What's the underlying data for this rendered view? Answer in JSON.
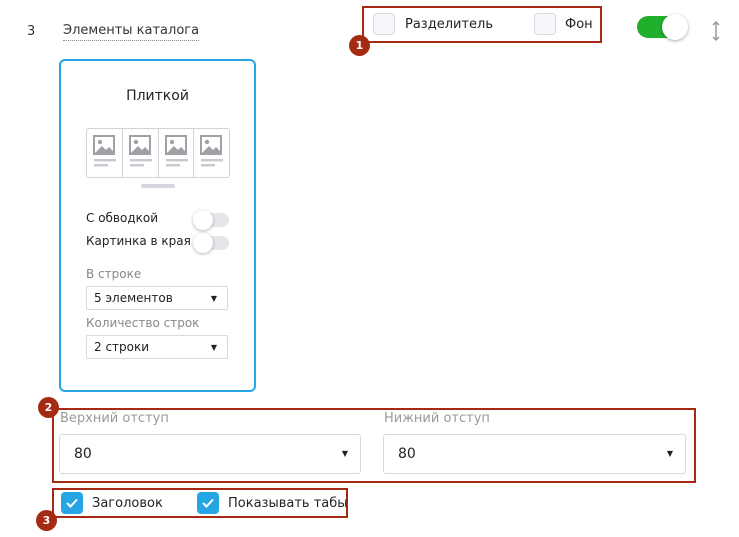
{
  "section": {
    "number": "3",
    "title": "Элементы каталога"
  },
  "badges": [
    "1",
    "2",
    "3"
  ],
  "options": {
    "divider_label": "Разделитель",
    "background_label": "Фон",
    "divider_checked": false,
    "background_checked": false
  },
  "section_toggle": {
    "enabled": true,
    "color": "#21b02c"
  },
  "card": {
    "title": "Плиткой",
    "border_color": "#26a5e4",
    "bordered_label": "С обводкой",
    "bordered_on": false,
    "edge_image_label": "Картинка в края",
    "edge_image_on": false,
    "per_row_label": "В строке",
    "per_row_value": "5 элементов",
    "rows_label": "Количество строк",
    "rows_value": "2 строки"
  },
  "spacing": {
    "top_label": "Верхний отступ",
    "top_value": "80",
    "bottom_label": "Нижний отступ",
    "bottom_value": "80"
  },
  "checks": {
    "heading_label": "Заголовок",
    "heading_checked": true,
    "tabs_label": "Показывать табы",
    "tabs_checked": true,
    "check_color": "#26a5e4"
  },
  "icons": [
    "image-icon",
    "chevron-down-icon",
    "checkmark-icon",
    "drag-handle-icon"
  ],
  "annotation_color": "#a52a14"
}
